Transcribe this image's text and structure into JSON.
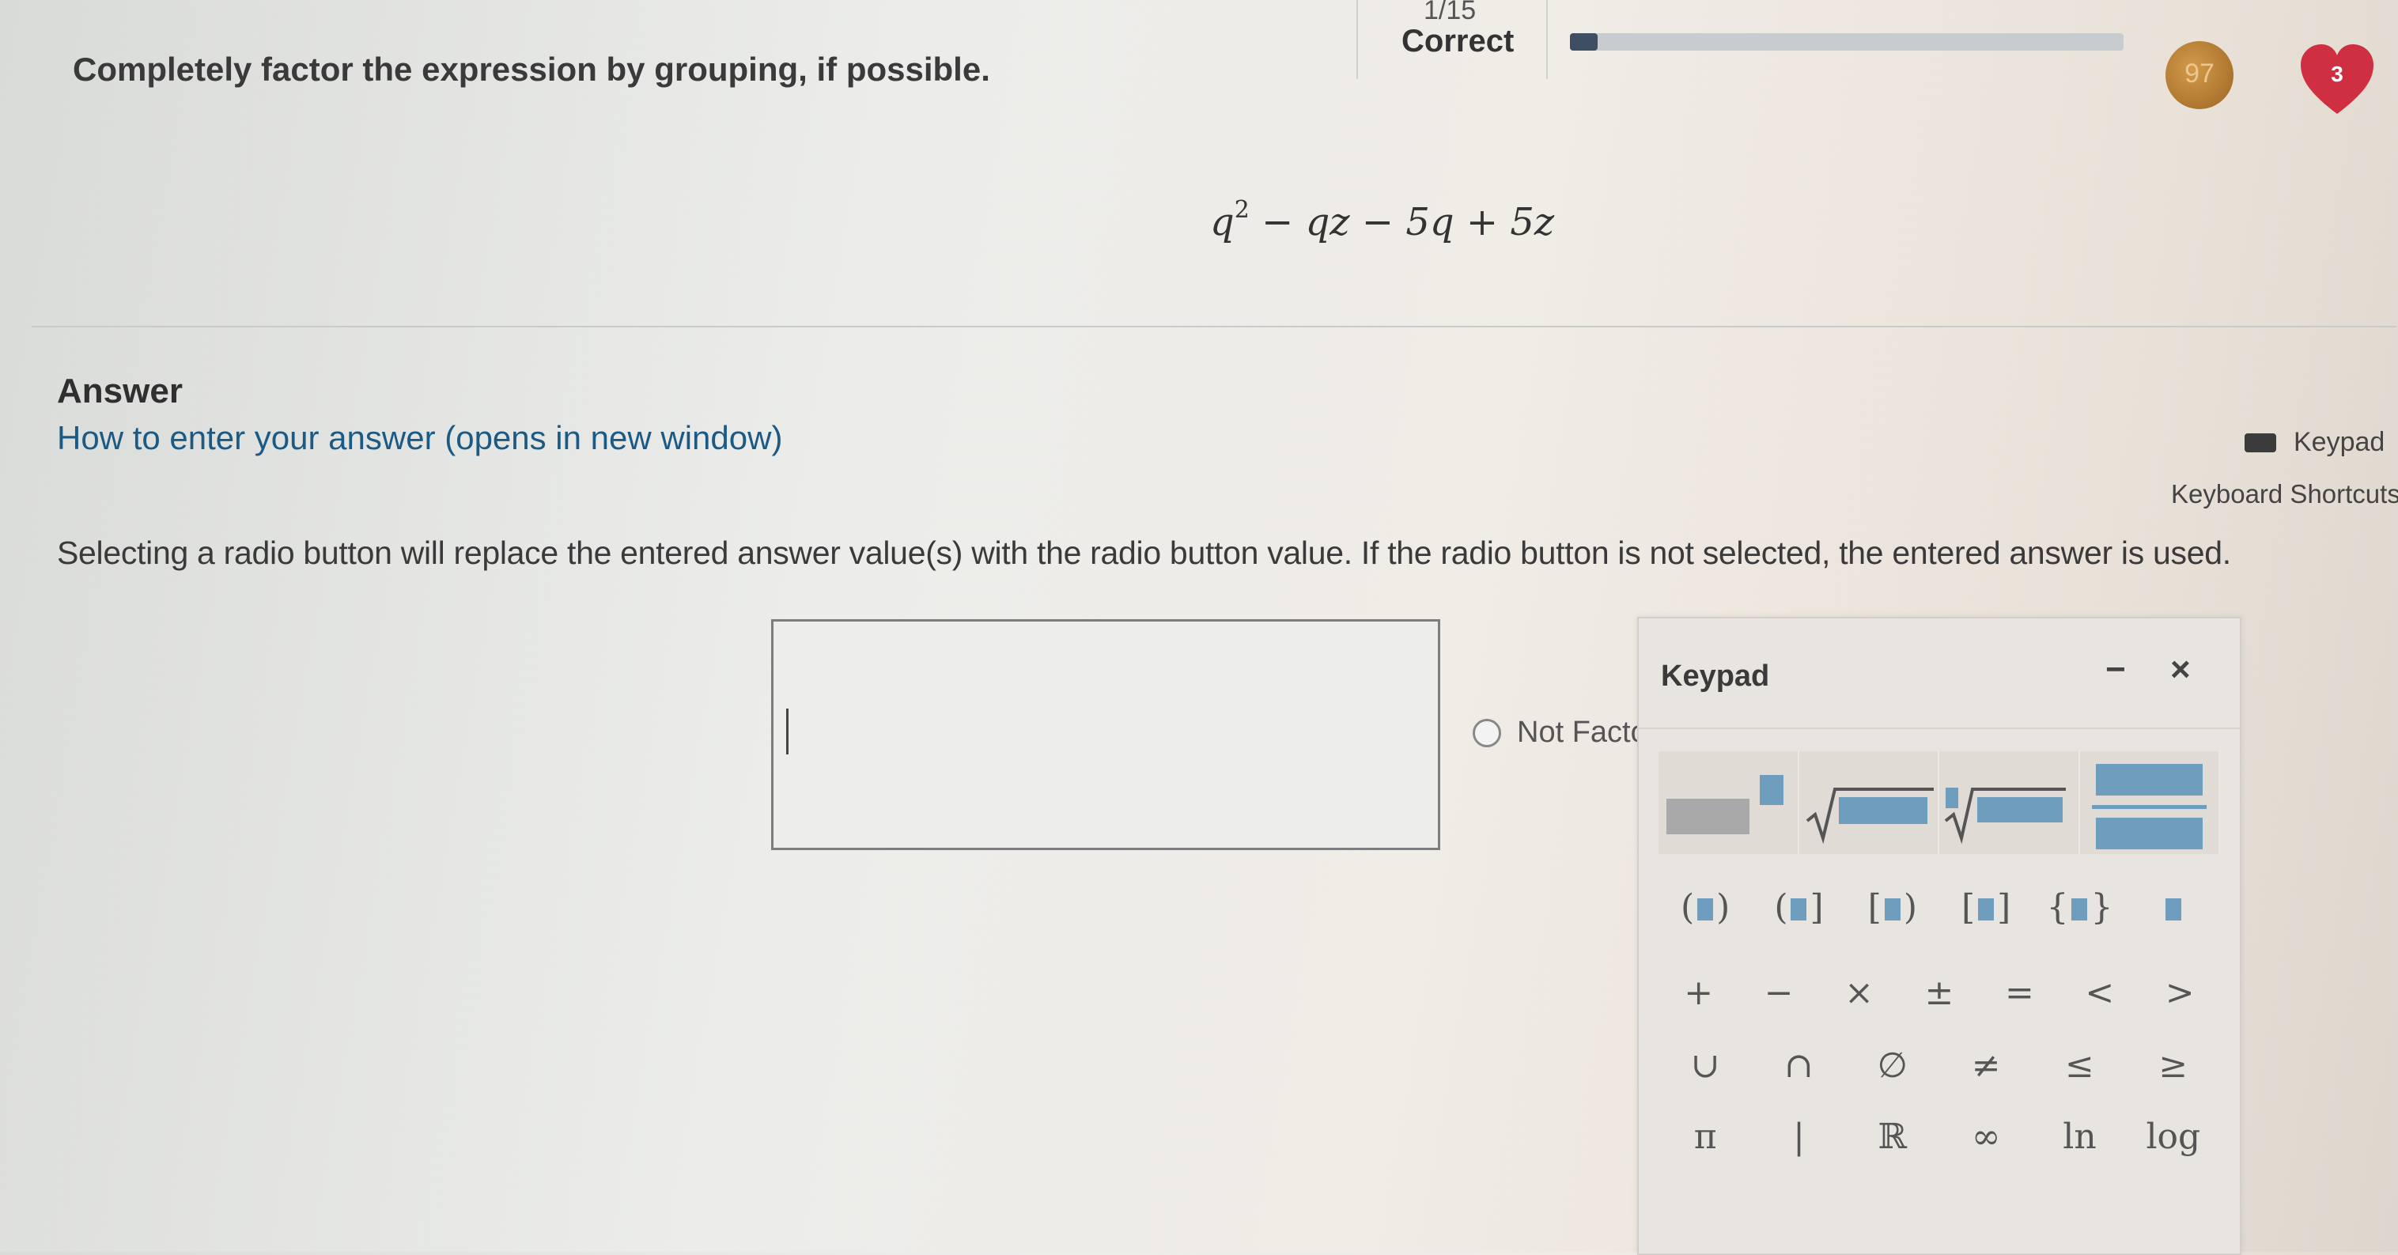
{
  "header": {
    "counter": "1/15",
    "status": "Correct",
    "progress_fraction": 0.05,
    "medal_label": "97",
    "hearts": "3"
  },
  "question": {
    "prompt": "Completely factor the expression by grouping, if possible.",
    "expression_base": "q",
    "expression_exp": "2",
    "expression_rest": " − qz − 5q + 5z"
  },
  "answer": {
    "heading": "Answer",
    "help_link": "How to enter your answer (opens in new window)",
    "keypad_toggle": "Keypad",
    "shortcuts_link": "Keyboard Shortcuts",
    "instruction": "Selecting a radio button will replace the entered answer value(s) with the radio button value. If the radio button is not selected, the entered answer is used.",
    "input_value": "",
    "radio_label": "Not Facto"
  },
  "keypad": {
    "title": "Keypad",
    "minimize": "−",
    "close": "×",
    "row2": [
      "(▮)",
      "(▮]",
      "[▮)",
      "[▮]",
      "{▮}",
      "▮"
    ],
    "row3": [
      "+",
      "−",
      "×",
      "±",
      "=",
      "<",
      ">"
    ],
    "row4": [
      "∪",
      "∩",
      "∅",
      "≠",
      "≤",
      "≥"
    ],
    "row5": [
      "π",
      "|",
      "ℝ",
      "∞",
      "ln",
      "log"
    ]
  },
  "colors": {
    "template_accent": "#6f9dbd",
    "link": "#1c5a86",
    "heart": "#cf3041"
  }
}
